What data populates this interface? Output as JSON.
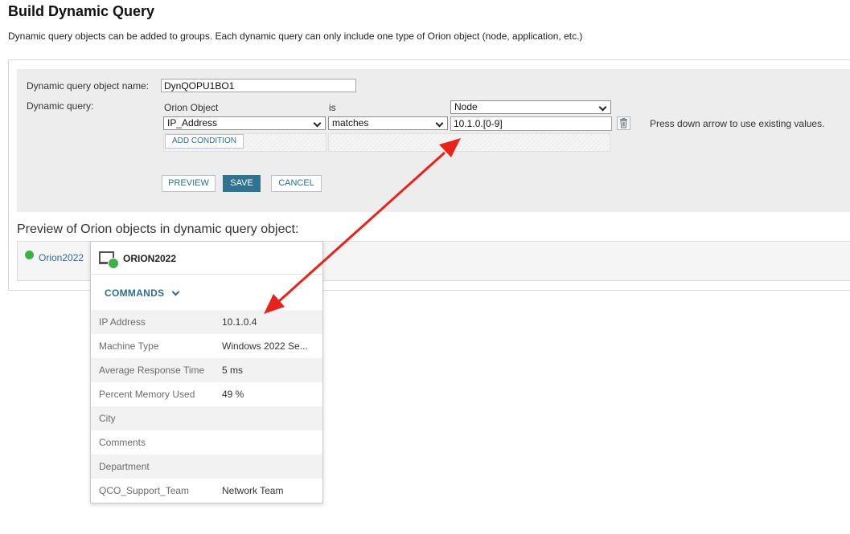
{
  "page": {
    "title": "Build Dynamic Query",
    "description": "Dynamic query objects can be added to groups. Each dynamic query can only include one type of Orion object (node, application, etc.)"
  },
  "builder": {
    "name_label": "Dynamic query object name:",
    "name_value": "DynQOPU1BO1",
    "query_label": "Dynamic query:",
    "orion_object_label": "Orion Object",
    "is_label": "is",
    "object_type_value": "Node",
    "field_value": "IP_Address",
    "operator_value": "matches",
    "value_input": "10.1.0.[0-9]",
    "hint": "Press down arrow to use existing values.",
    "add_condition_label": "ADD CONDITION",
    "preview_label": "PREVIEW",
    "save_label": "SAVE",
    "cancel_label": "CANCEL"
  },
  "preview": {
    "heading": "Preview of Orion objects in dynamic query object:",
    "item_label": "Orion2022"
  },
  "popup": {
    "node_name": "ORION2022",
    "commands_label": "COMMANDS",
    "properties": [
      {
        "key": "IP Address",
        "value": "10.1.0.4"
      },
      {
        "key": "Machine Type",
        "value": "Windows 2022 Se..."
      },
      {
        "key": "Average Response Time",
        "value": "5 ms"
      },
      {
        "key": "Percent Memory Used",
        "value": "49 %"
      },
      {
        "key": "City",
        "value": ""
      },
      {
        "key": "Comments",
        "value": ""
      },
      {
        "key": "Department",
        "value": ""
      },
      {
        "key": "QCO_Support_Team",
        "value": "Network Team"
      }
    ]
  },
  "colors": {
    "accent": "#2f7292",
    "status_up": "#3db04a",
    "annotation_arrow": "#e8231b"
  }
}
